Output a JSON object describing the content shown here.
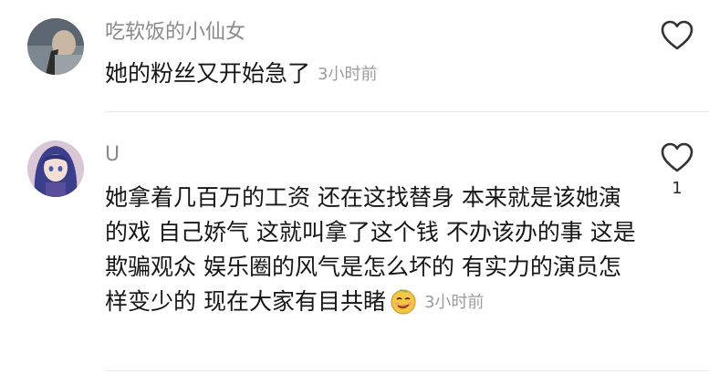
{
  "comments": [
    {
      "username": "吃软饭的小仙女",
      "text": "她的粉丝又开始急了",
      "time": "3小时前",
      "like_count": ""
    },
    {
      "username": "U",
      "text": "她拿着几百万的工资 还在这找替身 本来就是该她演的戏 自己娇气 这就叫拿了这个钱 不办该办的事 这是欺骗观众 娱乐圈的风气是怎么坏的 有实力的演员怎样变少的 现在大家有目共睹",
      "emoji": "smirking-face-sticker",
      "time": "3小时前",
      "like_count": "1"
    }
  ],
  "colors": {
    "username": "#8a8a8a",
    "text": "#161616",
    "time": "#9c9c9c",
    "divider": "#ebebeb"
  }
}
